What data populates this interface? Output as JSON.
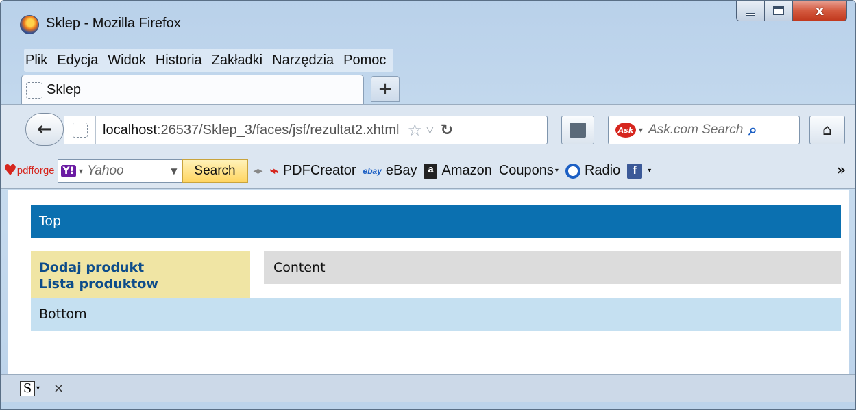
{
  "window": {
    "title": "Sklep - Mozilla Firefox",
    "controls": {
      "close": "x"
    }
  },
  "menu": {
    "items": [
      "Plik",
      "Edycja",
      "Widok",
      "Historia",
      "Zakładki",
      "Narzędzia",
      "Pomoc"
    ]
  },
  "tabs": [
    {
      "label": "Sklep",
      "active": true
    }
  ],
  "newtab_label": "+",
  "nav": {
    "url_host": "localhost",
    "url_rest": ":26537/Sklep_3/faces/jsf/rezultat2.xhtml",
    "search_placeholder": "Ask.com Search",
    "ask_logo": "Ask"
  },
  "bookmarks": {
    "pdfforge": "pdfforge",
    "yahoo_logo": "Y!",
    "yahoo_text": "Yahoo",
    "search_button": "Search",
    "items": [
      {
        "label": "PDFCreator",
        "icon": "pdf-icon"
      },
      {
        "label": "eBay",
        "icon": "ebay-icon"
      },
      {
        "label": "Amazon",
        "icon": "amazon-icon"
      },
      {
        "label": "Coupons",
        "icon": ""
      },
      {
        "label": "Radio",
        "icon": "radio-icon"
      }
    ],
    "ebay_icon_text": "ebay",
    "amazon_icon_text": "a",
    "fb_icon_text": "f"
  },
  "page": {
    "top": "Top",
    "menu_links": [
      "Dodaj produkt",
      "Lista produktow"
    ],
    "content": "Content",
    "bottom": "Bottom"
  },
  "addon_bar": {
    "s_icon": "S",
    "close": "×"
  },
  "colors": {
    "top_bar": "#0b70b0",
    "left_menu": "#f0e5a4",
    "content_box": "#dcdcdc",
    "bottom_bar": "#c5e0f1",
    "link": "#0d4c8a"
  }
}
